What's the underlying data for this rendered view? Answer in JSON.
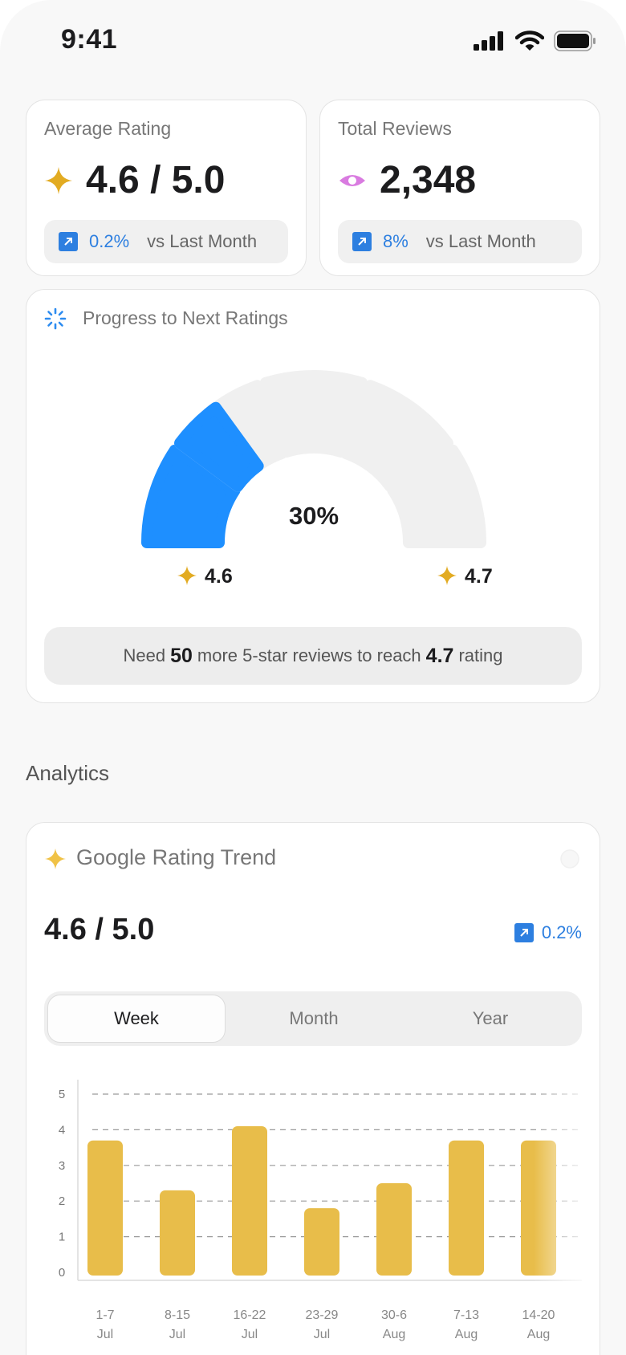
{
  "status_bar": {
    "time": "9:41"
  },
  "kpis": {
    "average_rating": {
      "title": "Average Rating",
      "value": "4.6 / 5.0",
      "change": "0.2%",
      "comparison": "vs Last Month",
      "icon": "sparkle-star-icon"
    },
    "total_reviews": {
      "title": "Total Reviews",
      "value": "2,348",
      "change": "8%",
      "comparison": "vs Last Month",
      "icon": "eye-icon"
    }
  },
  "progress": {
    "title": "Progress to Next Ratings",
    "percent_label": "30%",
    "percent": 30,
    "current_rating": "4.6",
    "next_rating": "4.7",
    "need_prefix": "Need",
    "need_count": "50",
    "need_middle": "more 5-star reviews to reach",
    "need_target": "4.7",
    "need_suffix": "rating"
  },
  "analytics": {
    "section_title": "Analytics",
    "trend_card": {
      "title": "Google Rating Trend",
      "value": "4.6 / 5.0",
      "change": "0.2%",
      "tabs": [
        {
          "label": "Week",
          "active": true
        },
        {
          "label": "Month",
          "active": false
        },
        {
          "label": "Year",
          "active": false
        }
      ]
    }
  },
  "colors": {
    "accent_blue": "#2d7fe0",
    "gauge_blue": "#1e8fff",
    "gauge_empty": "#f0f0f0",
    "bar_gold": "#e8bd4a",
    "star_gold": "#e2ab22",
    "eye_pink": "#d97be0"
  },
  "chart_data": {
    "type": "bar",
    "categories": [
      "1-7 Jul",
      "8-15 Jul",
      "16-22 Jul",
      "23-29 Jul",
      "30-6 Aug",
      "7-13 Aug",
      "14-20 Aug"
    ],
    "category_lines": [
      [
        "1-7",
        "Jul"
      ],
      [
        "8-15",
        "Jul"
      ],
      [
        "16-22",
        "Jul"
      ],
      [
        "23-29",
        "Jul"
      ],
      [
        "30-6",
        "Aug"
      ],
      [
        "7-13",
        "Aug"
      ],
      [
        "14-20",
        "Aug"
      ]
    ],
    "values": [
      3.7,
      2.3,
      4.1,
      1.8,
      2.5,
      3.7,
      3.7
    ],
    "y_ticks": [
      "0",
      "1",
      "2",
      "3",
      "4",
      "5"
    ],
    "ylim": [
      0,
      5
    ],
    "grid": true,
    "title": "",
    "xlabel": "",
    "ylabel": ""
  }
}
